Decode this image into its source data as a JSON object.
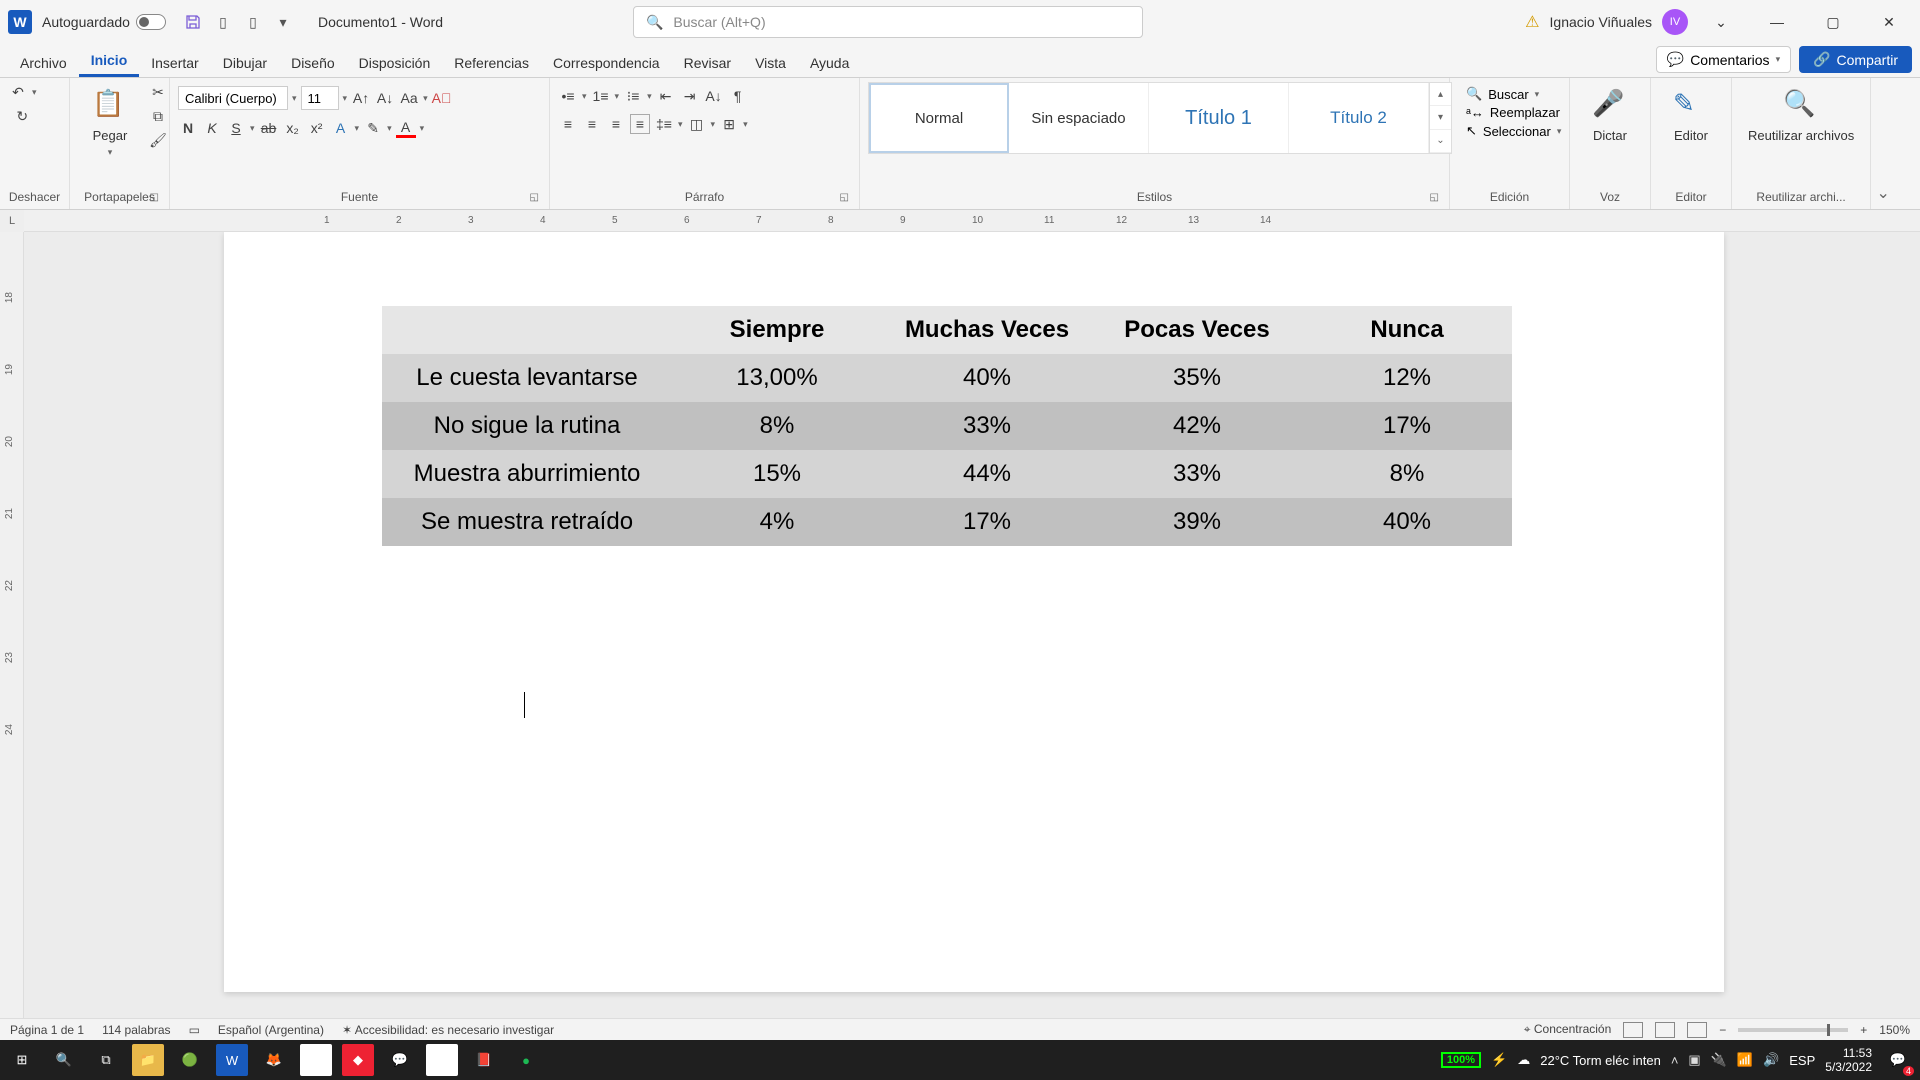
{
  "titlebar": {
    "autosave": "Autoguardado",
    "doc": "Documento1  -  Word",
    "search_placeholder": "Buscar (Alt+Q)",
    "user": "Ignacio Viñuales",
    "initials": "IV"
  },
  "tabs": {
    "archivo": "Archivo",
    "inicio": "Inicio",
    "insertar": "Insertar",
    "dibujar": "Dibujar",
    "diseno": "Diseño",
    "disposicion": "Disposición",
    "referencias": "Referencias",
    "correspondencia": "Correspondencia",
    "revisar": "Revisar",
    "vista": "Vista",
    "ayuda": "Ayuda",
    "comentarios": "Comentarios",
    "compartir": "Compartir"
  },
  "ribbon": {
    "deshacer": "Deshacer",
    "portapapeles": "Portapapeles",
    "pegar": "Pegar",
    "fuente": "Fuente",
    "font_name": "Calibri (Cuerpo)",
    "font_size": "11",
    "parrafo": "Párrafo",
    "estilos": "Estilos",
    "normal": "Normal",
    "sin_espaciado": "Sin espaciado",
    "titulo1": "Título 1",
    "titulo2": "Título 2",
    "edicion": "Edición",
    "buscar": "Buscar",
    "reemplazar": "Reemplazar",
    "seleccionar": "Seleccionar",
    "voz": "Voz",
    "dictar": "Dictar",
    "editor": "Editor",
    "reutilizar": "Reutilizar archivos",
    "reutilizar_grp": "Reutilizar archi..."
  },
  "table": {
    "h1": "Siempre",
    "h2": "Muchas Veces",
    "h3": "Pocas Veces",
    "h4": "Nunca",
    "r1l": "Le cuesta levantarse",
    "r1c1": "13,00%",
    "r1c2": "40%",
    "r1c3": "35%",
    "r1c4": "12%",
    "r2l": "No sigue la rutina",
    "r2c1": "8%",
    "r2c2": "33%",
    "r2c3": "42%",
    "r2c4": "17%",
    "r3l": "Muestra aburrimiento",
    "r3c1": "15%",
    "r3c2": "44%",
    "r3c3": "33%",
    "r3c4": "8%",
    "r4l": "Se muestra retraído",
    "r4c1": "4%",
    "r4c2": "17%",
    "r4c3": "39%",
    "r4c4": "40%"
  },
  "status": {
    "page": "Página 1 de 1",
    "words": "114 palabras",
    "lang": "Español (Argentina)",
    "access": "Accesibilidad: es necesario investigar",
    "focus": "Concentración",
    "zoom": "150%"
  },
  "taskbar": {
    "battery": "100%",
    "weather": "22°C  Torm eléc inten",
    "ime": "ESP",
    "time": "11:53",
    "date": "5/3/2022",
    "notif": "4"
  },
  "ruler": {
    "n1": "1",
    "n2": "2",
    "n3": "3",
    "n4": "4",
    "n5": "5",
    "n6": "6",
    "n7": "7",
    "n8": "8",
    "n9": "9",
    "n10": "10",
    "n11": "11",
    "n12": "12",
    "n13": "13",
    "n14": "14",
    "v18": "18",
    "v19": "19",
    "v20": "20",
    "v21": "21",
    "v22": "22",
    "v23": "23",
    "v24": "24"
  }
}
